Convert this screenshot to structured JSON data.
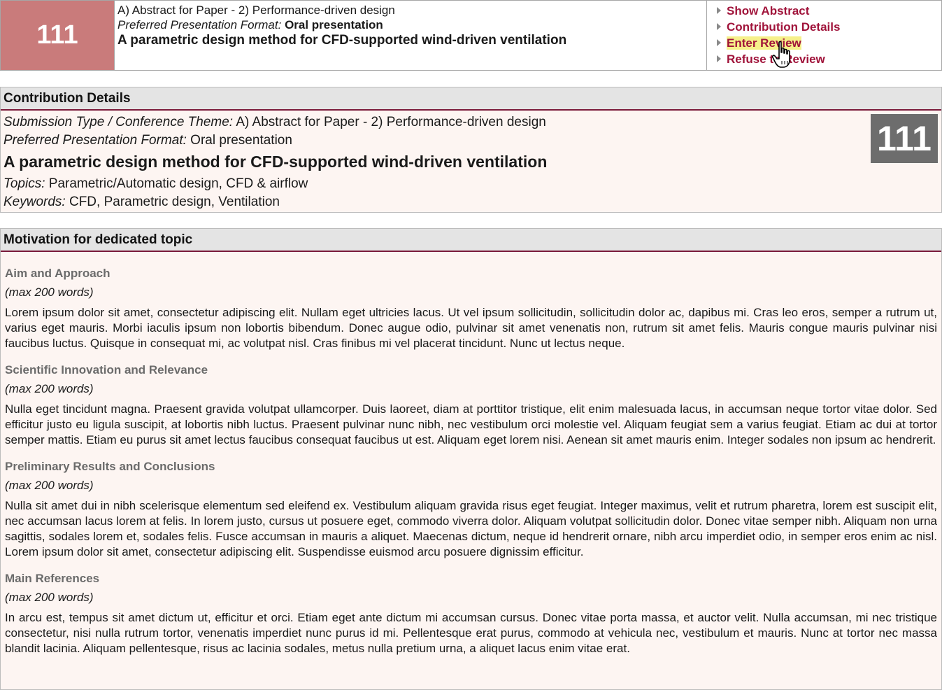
{
  "header": {
    "id": "111",
    "type_line": "A) Abstract for Paper - 2) Performance-driven design",
    "format_label": "Preferred Presentation Format:",
    "format_value": "Oral presentation",
    "title": "A parametric design method for CFD-supported wind-driven ventilation",
    "actions": [
      {
        "label": "Show Abstract"
      },
      {
        "label": "Contribution Details"
      },
      {
        "label": "Enter Review",
        "highlighted": true
      },
      {
        "label": "Refuse to Review"
      }
    ],
    "colors": {
      "id_box": "#c97b7b",
      "action_link": "#a0133a",
      "highlight": "#f6f08a"
    }
  },
  "details": {
    "heading": "Contribution Details",
    "type_label": "Submission Type / Conference Theme:",
    "type_value": "A) Abstract for Paper - 2) Performance-driven design",
    "format_label": "Preferred Presentation Format:",
    "format_value": "Oral presentation",
    "title": "A parametric design method for CFD-supported wind-driven ventilation",
    "topics_label": "Topics:",
    "topics_value": "Parametric/Automatic design, CFD & airflow",
    "keywords_label": "Keywords:",
    "keywords_value": "CFD, Parametric design, Ventilation",
    "id": "111"
  },
  "motivation": {
    "heading": "Motivation for dedicated topic",
    "sections": [
      {
        "title": "Aim and Approach",
        "note": "(max 200 words)",
        "text": "Lorem ipsum dolor sit amet, consectetur adipiscing elit. Nullam eget ultricies lacus. Ut vel ipsum sollicitudin, sollicitudin dolor ac, dapibus mi. Cras leo eros, semper a rutrum ut, varius eget mauris. Morbi iaculis ipsum non lobortis bibendum. Donec augue odio, pulvinar sit amet venenatis non, rutrum sit amet felis. Mauris congue mauris pulvinar nisi faucibus luctus. Quisque in consequat mi, ac volutpat nisl. Cras finibus mi vel placerat tincidunt. Nunc ut lectus neque."
      },
      {
        "title": "Scientific Innovation and Relevance",
        "note": "(max 200 words)",
        "text": "Nulla eget tincidunt magna. Praesent gravida volutpat ullamcorper. Duis laoreet, diam at porttitor tristique, elit enim malesuada lacus, in accumsan neque tortor vitae dolor. Sed efficitur justo eu ligula suscipit, at lobortis nibh luctus. Praesent pulvinar nunc nibh, nec vestibulum orci molestie vel. Aliquam feugiat sem a varius feugiat. Etiam ac dui at tortor semper mattis. Etiam eu purus sit amet lectus faucibus consequat faucibus ut est. Aliquam eget lorem nisi. Aenean sit amet mauris enim. Integer sodales non ipsum ac hendrerit."
      },
      {
        "title": "Preliminary Results and Conclusions",
        "note": "(max 200 words)",
        "text": "Nulla sit amet dui in nibh scelerisque elementum sed eleifend ex. Vestibulum aliquam gravida risus eget feugiat. Integer maximus, velit et rutrum pharetra, lorem est suscipit elit, nec accumsan lacus lorem at felis. In lorem justo, cursus ut posuere eget, commodo viverra dolor. Aliquam volutpat sollicitudin dolor. Donec vitae semper nibh. Aliquam non urna sagittis, sodales lorem et, sodales felis. Fusce accumsan in mauris a aliquet. Maecenas dictum, neque id hendrerit ornare, nibh arcu imperdiet odio, in semper eros enim ac nisl. Lorem ipsum dolor sit amet, consectetur adipiscing elit. Suspendisse euismod arcu posuere dignissim efficitur."
      },
      {
        "title": "Main References",
        "note": "(max 200 words)",
        "text": "In arcu est, tempus sit amet dictum ut, efficitur et orci. Etiam eget ante dictum mi accumsan cursus. Donec vitae porta massa, et auctor velit. Nulla accumsan, mi nec tristique consectetur, nisi nulla rutrum tortor, venenatis imperdiet nunc purus id mi. Pellentesque erat purus, commodo at vehicula nec, vestibulum et mauris. Nunc at tortor nec massa blandit lacinia. Aliquam pellentesque, risus ac lacinia sodales, metus nulla pretium urna, a aliquet lacus enim vitae erat."
      }
    ]
  }
}
